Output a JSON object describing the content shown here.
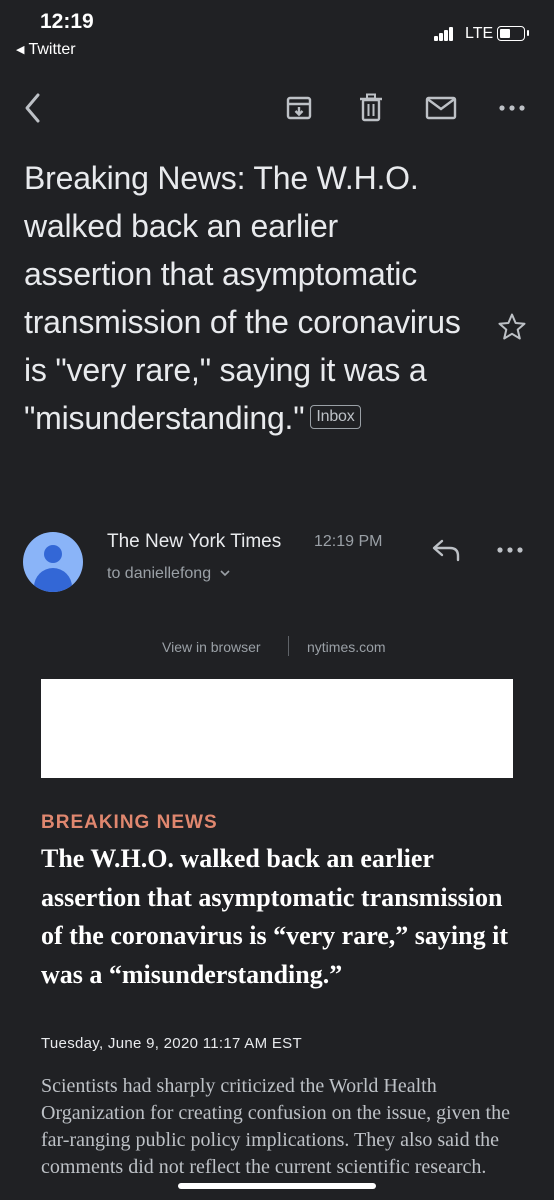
{
  "status_bar": {
    "time": "12:19",
    "back_app": "Twitter",
    "network": "LTE"
  },
  "toolbar": {
    "back_icon": "chevron-left-icon",
    "archive_icon": "archive-icon",
    "delete_icon": "trash-icon",
    "mark_unread_icon": "mail-icon",
    "more_icon": "more-horizontal-icon"
  },
  "email": {
    "subject": "Breaking News: The W.H.O. walked back an earlier assertion that asymptomatic transmission of the coronavirus is \"very rare,\" saying it was a \"misunderstanding.\"",
    "label": "Inbox",
    "sender": "The New York Times",
    "time": "12:19 PM",
    "recipient": "to daniellefong"
  },
  "content": {
    "view_in_browser": "View in browser",
    "site_link": "nytimes.com",
    "kicker": "BREAKING NEWS",
    "headline": "The W.H.O. walked back an earlier assertion that asymptomatic transmission of the coronavirus is “very rare,” saying it was a “misunderstanding.”",
    "dateline": "Tuesday, June 9, 2020 11:17 AM EST",
    "body": "Scientists had sharply criticized the World Health Organization for creating confusion on the issue, given the far-ranging public policy implications. They also said the comments did not reflect the current scientific research."
  },
  "colors": {
    "background": "#202124",
    "kicker": "#e0876f",
    "avatar": "#8ab4f8"
  }
}
